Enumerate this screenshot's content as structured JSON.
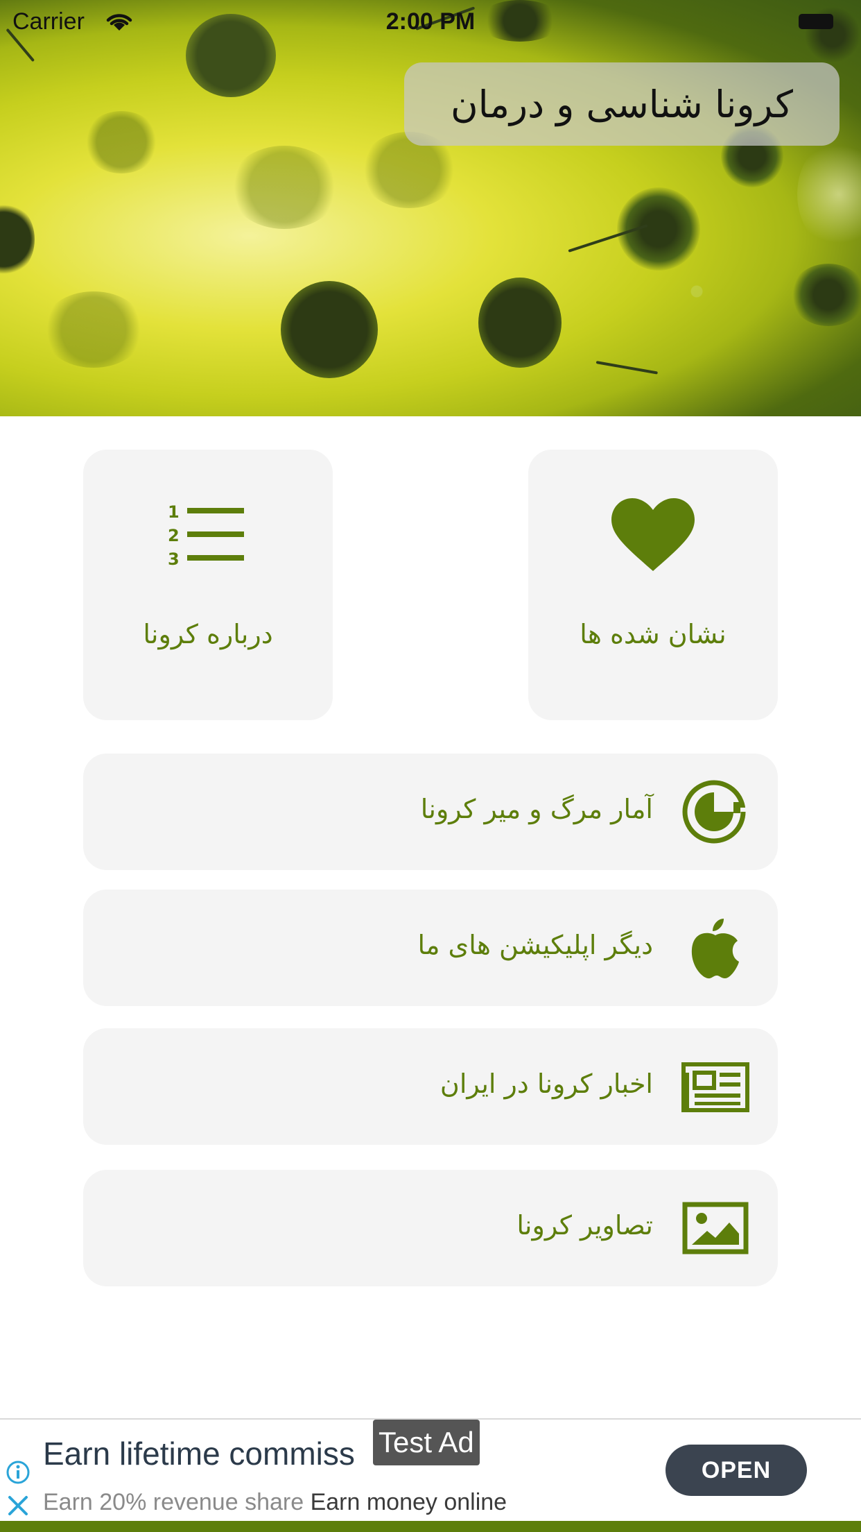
{
  "status_bar": {
    "carrier": "Carrier",
    "time": "2:00 PM"
  },
  "header": {
    "title": "کرونا شناسی و درمان"
  },
  "grid": [
    {
      "label": "درباره کرونا",
      "icon": "numbered-list-icon"
    },
    {
      "label": "نشان شده ها",
      "icon": "heart-icon"
    }
  ],
  "menu": [
    {
      "label": "آمار مرگ و میر کرونا",
      "icon": "pacman-stats-icon"
    },
    {
      "label": "دیگر اپلیکیشن های ما",
      "icon": "apple-icon"
    },
    {
      "label": "اخبار کرونا در ایران",
      "icon": "newspaper-icon"
    },
    {
      "label": "تصاویر کرونا",
      "icon": "image-icon"
    }
  ],
  "ad": {
    "badge": "Test Ad",
    "title": "Earn lifetime commiss",
    "sub_muted": "Earn 20% revenue share ",
    "sub_strong": "Earn money online",
    "cta": "OPEN"
  },
  "colors": {
    "accent": "#5d7e0b",
    "tile_bg": "#f4f4f4",
    "ad_button": "#3b4450"
  }
}
